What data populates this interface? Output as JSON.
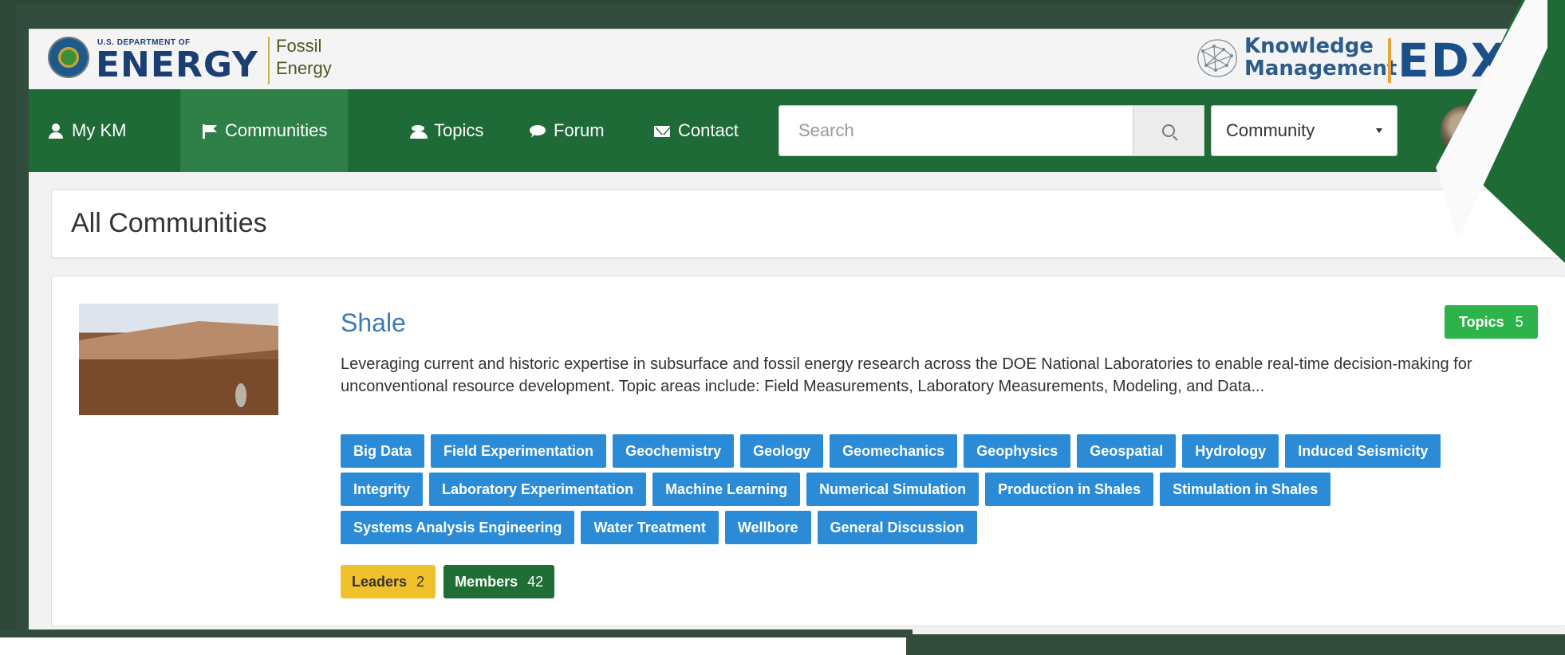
{
  "brand": {
    "doe_small": "U.S. DEPARTMENT OF",
    "doe_big": "ENERGY",
    "fe_line1": "Fossil",
    "fe_line2": "Energy",
    "km_line1": "Knowledge",
    "km_line2": "Management",
    "edx": "EDX"
  },
  "nav": {
    "items": [
      {
        "label": "My KM",
        "icon": "user-icon",
        "active": false
      },
      {
        "label": "Communities",
        "icon": "flag-icon",
        "active": true
      },
      {
        "label": "Topics",
        "icon": "users-icon",
        "active": false
      },
      {
        "label": "Forum",
        "icon": "chat-bubble-icon",
        "active": false
      },
      {
        "label": "Contact",
        "icon": "envelope-icon",
        "active": false
      }
    ],
    "search_placeholder": "Search",
    "search_value": "",
    "scope_selected": "Community"
  },
  "page": {
    "title": "All Communities"
  },
  "community": {
    "name": "Shale",
    "description": "Leveraging current and historic expertise in subsurface and fossil energy research across the DOE National Laboratories to enable real-time decision-making for unconventional resource development. Topic areas include: Field Measurements, Laboratory Measurements, Modeling, and Data...",
    "topics_label": "Topics",
    "topics_count": "5",
    "tags": [
      "Big Data",
      "Field Experimentation",
      "Geochemistry",
      "Geology",
      "Geomechanics",
      "Geophysics",
      "Geospatial",
      "Hydrology",
      "Induced Seismicity",
      "Integrity",
      "Laboratory Experimentation",
      "Machine Learning",
      "Numerical Simulation",
      "Production in Shales",
      "Stimulation in Shales",
      "Systems Analysis Engineering",
      "Water Treatment",
      "Wellbore",
      "General Discussion"
    ],
    "leaders_label": "Leaders",
    "leaders_count": "2",
    "members_label": "Members",
    "members_count": "42"
  },
  "colors": {
    "nav_green": "#1e6b38",
    "tag_blue": "#2b8bd6",
    "topics_green": "#2db34a",
    "leaders_yellow": "#f0c12b",
    "members_green": "#1f6e33",
    "link_blue": "#3a7ab8"
  }
}
